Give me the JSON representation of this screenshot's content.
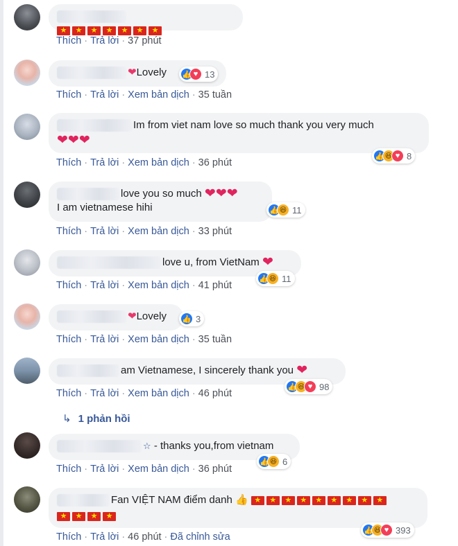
{
  "colors": {
    "link": "#385898",
    "bubble": "#f2f3f5",
    "like": "#2078f4",
    "love": "#f33e58",
    "haha": "#f7b125"
  },
  "actions": {
    "like": "Thích",
    "reply": "Trả lời",
    "translate": "Xem bản dịch",
    "edited": "Đã chỉnh sửa"
  },
  "comments": [
    {
      "text": "",
      "time": "37 phút",
      "reaction_count": ""
    },
    {
      "text": "Lovely",
      "time": "35 tuần",
      "reaction_count": "13"
    },
    {
      "text": "Im from viet nam love so much thank you very much",
      "time": "36 phút",
      "reaction_count": "8"
    },
    {
      "text": "love you so much",
      "text2": "I am vietnamese hihi",
      "time": "33 phút",
      "reaction_count": "11"
    },
    {
      "text": "love u, from VietNam",
      "time": "41 phút",
      "reaction_count": "11"
    },
    {
      "text": "Lovely",
      "time": "35 tuần",
      "reaction_count": "3"
    },
    {
      "text": "am Vietnamese, I sincerely thank you",
      "time": "46 phút",
      "reaction_count": "98"
    },
    {
      "text": "- thanks you,from vietnam",
      "time": "36 phút",
      "reaction_count": "6"
    },
    {
      "text": "Fan VIỆT NAM điểm danh",
      "time": "46 phút",
      "reaction_count": "393"
    }
  ],
  "replies_label": "1 phản hồi"
}
